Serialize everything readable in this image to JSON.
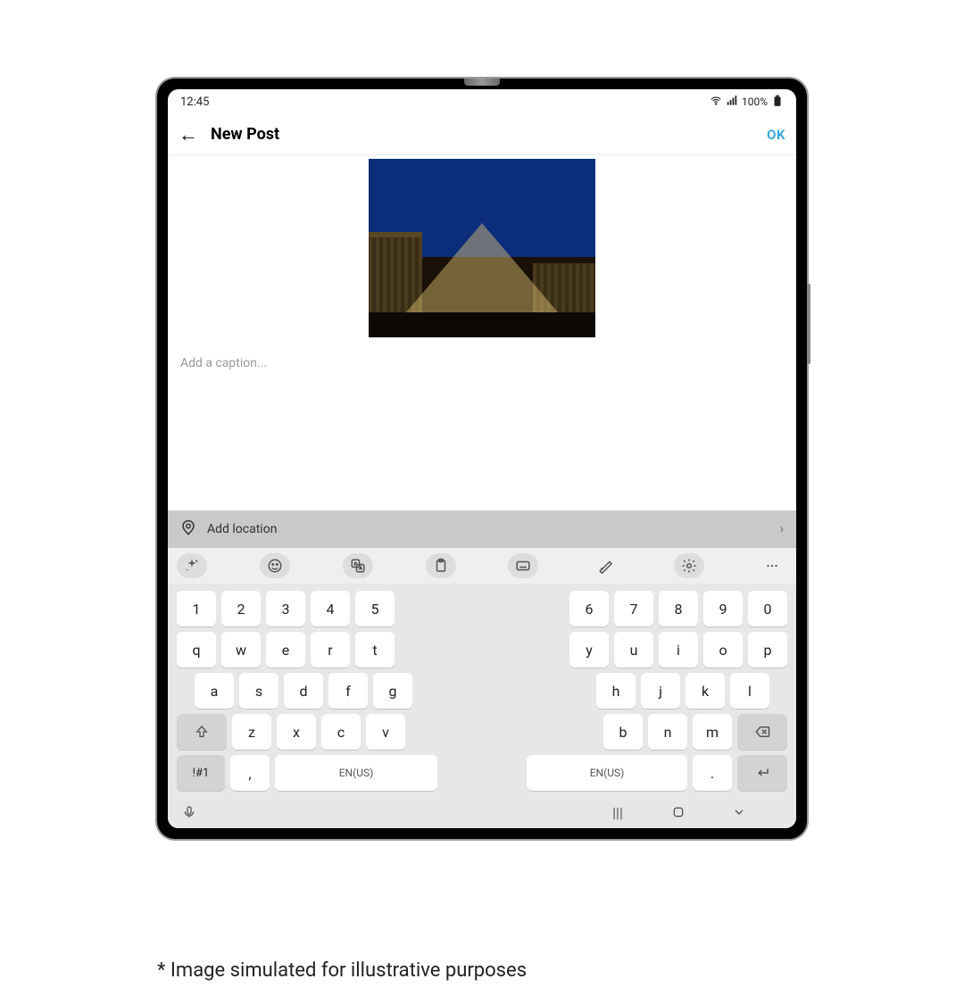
{
  "statusbar": {
    "time": "12:45",
    "battery": "100%"
  },
  "header": {
    "title": "New Post",
    "ok": "OK"
  },
  "caption": {
    "placeholder": "Add a caption..."
  },
  "location": {
    "label": "Add location"
  },
  "keyboard": {
    "row_num_l": [
      "1",
      "2",
      "3",
      "4",
      "5"
    ],
    "row_num_r": [
      "6",
      "7",
      "8",
      "9",
      "0"
    ],
    "row1_l": [
      "q",
      "w",
      "e",
      "r",
      "t"
    ],
    "row1_r": [
      "y",
      "u",
      "i",
      "o",
      "p"
    ],
    "row2_l": [
      "a",
      "s",
      "d",
      "f",
      "g"
    ],
    "row2_r": [
      "h",
      "j",
      "k",
      "l"
    ],
    "row3_l": [
      "z",
      "x",
      "c",
      "v"
    ],
    "row3_r": [
      "b",
      "n",
      "m"
    ],
    "sym": "!#1",
    "comma": ",",
    "period": ".",
    "space_label": "EN(US)"
  },
  "disclaimer": "* Image simulated for illustrative purposes"
}
